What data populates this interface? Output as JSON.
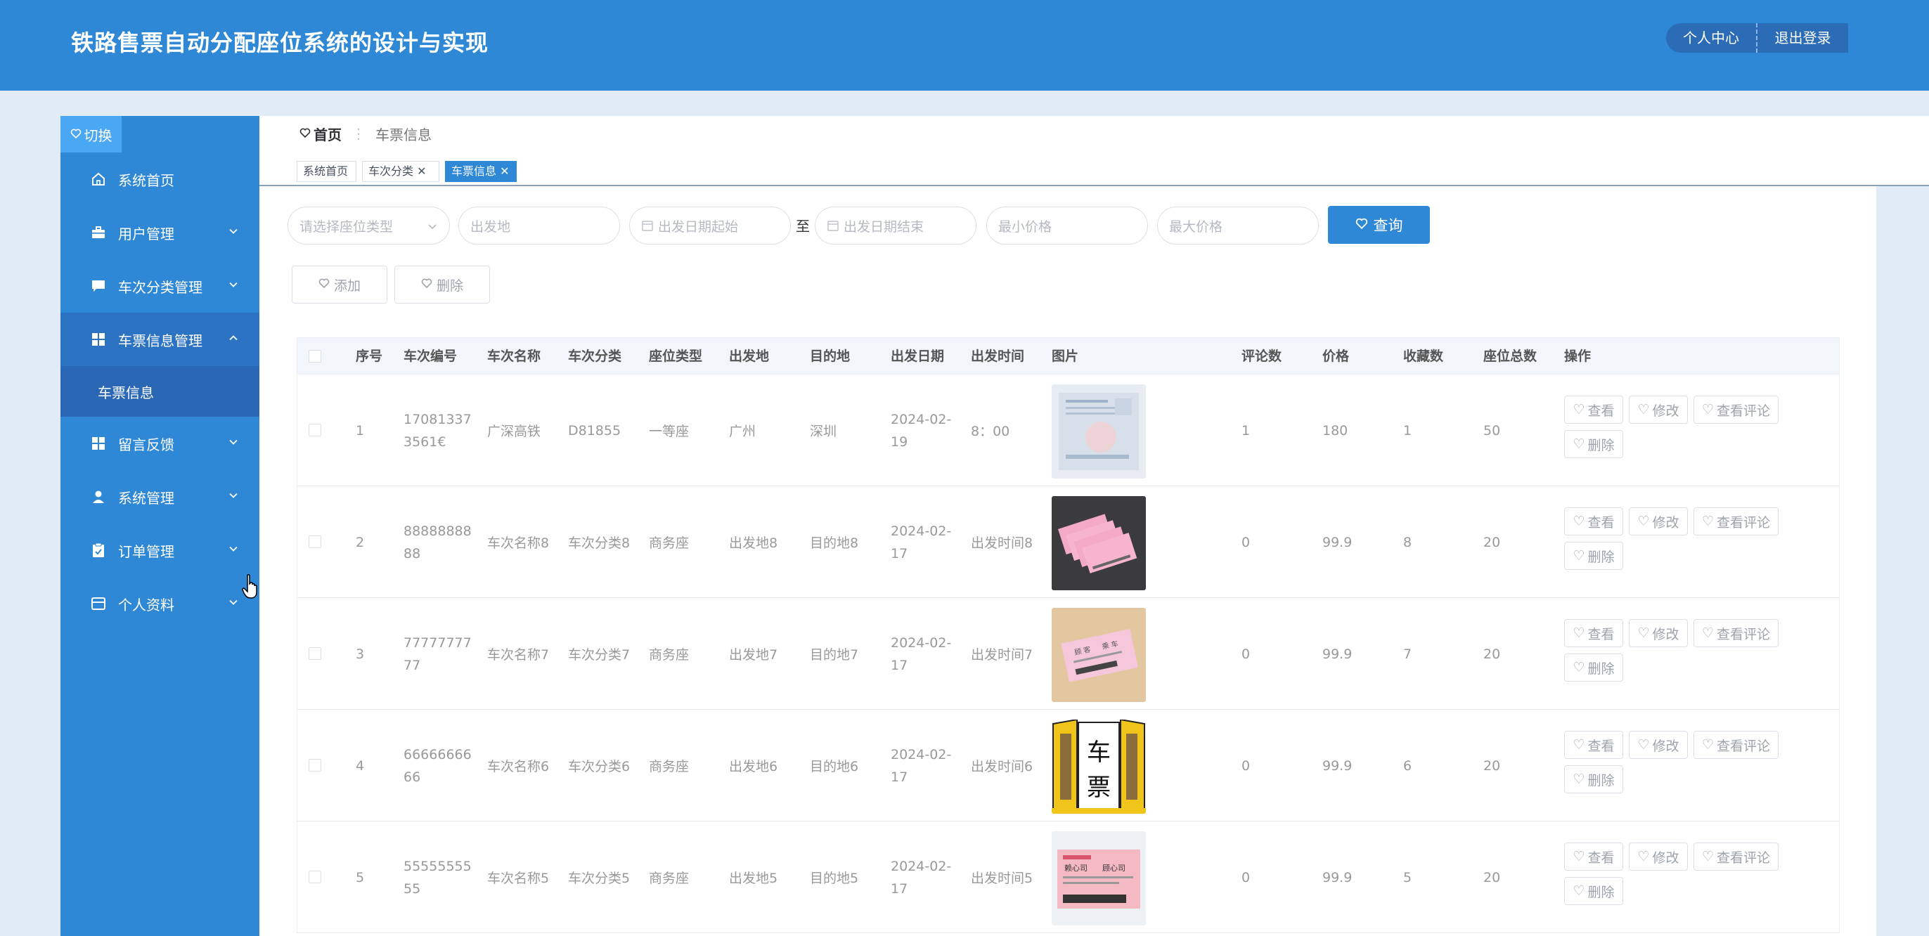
{
  "app": {
    "title": "铁路售票自动分配座位系统的设计与实现"
  },
  "header": {
    "profile_label": "个人中心",
    "logout_label": "退出登录"
  },
  "sidebar": {
    "toggle_label": "切换",
    "items": [
      {
        "label": "系统首页",
        "icon": "home-icon"
      },
      {
        "label": "用户管理",
        "icon": "briefcase-icon"
      },
      {
        "label": "车次分类管理",
        "icon": "chat-icon"
      },
      {
        "label": "车票信息管理",
        "icon": "grid-icon"
      },
      {
        "label": "留言反馈",
        "icon": "grid-icon"
      },
      {
        "label": "系统管理",
        "icon": "user-icon"
      },
      {
        "label": "订单管理",
        "icon": "clipboard-icon"
      },
      {
        "label": "个人资料",
        "icon": "card-icon"
      }
    ],
    "sub_item_label": "车票信息"
  },
  "breadcrumb": {
    "home": "首页",
    "current": "车票信息"
  },
  "tags": [
    {
      "label": "系统首页",
      "closable": false
    },
    {
      "label": "车次分类",
      "closable": true
    },
    {
      "label": "车票信息",
      "closable": true,
      "active": true
    }
  ],
  "search": {
    "seat_type_placeholder": "请选择座位类型",
    "departure_placeholder": "出发地",
    "date_start_placeholder": "出发日期起始",
    "to_label": "至",
    "date_end_placeholder": "出发日期结束",
    "min_price_placeholder": "最小价格",
    "max_price_placeholder": "最大价格",
    "query_label": "查询"
  },
  "actions": {
    "add_label": "添加",
    "delete_label": "删除"
  },
  "table": {
    "headers": [
      "序号",
      "车次编号",
      "车次名称",
      "车次分类",
      "座位类型",
      "出发地",
      "目的地",
      "出发日期",
      "出发时间",
      "图片",
      "评论数",
      "价格",
      "收藏数",
      "座位总数",
      "操作"
    ],
    "rows": [
      {
        "index": "1",
        "code_l1": "17081337",
        "code_l2": "3561€",
        "name": "广深高铁",
        "category": "D81855",
        "seat": "一等座",
        "from": "广州",
        "to": "深圳",
        "date_l1": "2024-02-",
        "date_l2": "19",
        "time": "8：00",
        "comments": "1",
        "price": "180",
        "favorites": "1",
        "seats": "50"
      },
      {
        "index": "2",
        "code_l1": "88888888",
        "code_l2": "88",
        "name": "车次名称8",
        "category": "车次分类8",
        "seat": "商务座",
        "from": "出发地8",
        "to": "目的地8",
        "date_l1": "2024-02-",
        "date_l2": "17",
        "time": "出发时间8",
        "comments": "0",
        "price": "99.9",
        "favorites": "8",
        "seats": "20"
      },
      {
        "index": "3",
        "code_l1": "77777777",
        "code_l2": "77",
        "name": "车次名称7",
        "category": "车次分类7",
        "seat": "商务座",
        "from": "出发地7",
        "to": "目的地7",
        "date_l1": "2024-02-",
        "date_l2": "17",
        "time": "出发时间7",
        "comments": "0",
        "price": "99.9",
        "favorites": "7",
        "seats": "20"
      },
      {
        "index": "4",
        "code_l1": "66666666",
        "code_l2": "66",
        "name": "车次名称6",
        "category": "车次分类6",
        "seat": "商务座",
        "from": "出发地6",
        "to": "目的地6",
        "date_l1": "2024-02-",
        "date_l2": "17",
        "time": "出发时间6",
        "comments": "0",
        "price": "99.9",
        "favorites": "6",
        "seats": "20"
      },
      {
        "index": "5",
        "code_l1": "55555555",
        "code_l2": "55",
        "name": "车次名称5",
        "category": "车次分类5",
        "seat": "商务座",
        "from": "出发地5",
        "to": "目的地5",
        "date_l1": "2024-02-",
        "date_l2": "17",
        "time": "出发时间5",
        "comments": "0",
        "price": "99.9",
        "favorites": "5",
        "seats": "20"
      }
    ],
    "row_ops": {
      "view": "查看",
      "edit": "修改",
      "view_comments": "查看评论",
      "delete": "删除"
    },
    "poster_text": {
      "line1": "车",
      "line2": "票"
    },
    "ticket_text": {
      "name_a": "顾 客",
      "name_b": "乘 车",
      "name_c": "赖心司",
      "name_d": "顾心司"
    }
  },
  "colors": {
    "primary": "#2f88d6",
    "sidebar_active": "#2d73c4",
    "submenu": "#2a67b4",
    "page_bg": "#e0ebf7"
  }
}
